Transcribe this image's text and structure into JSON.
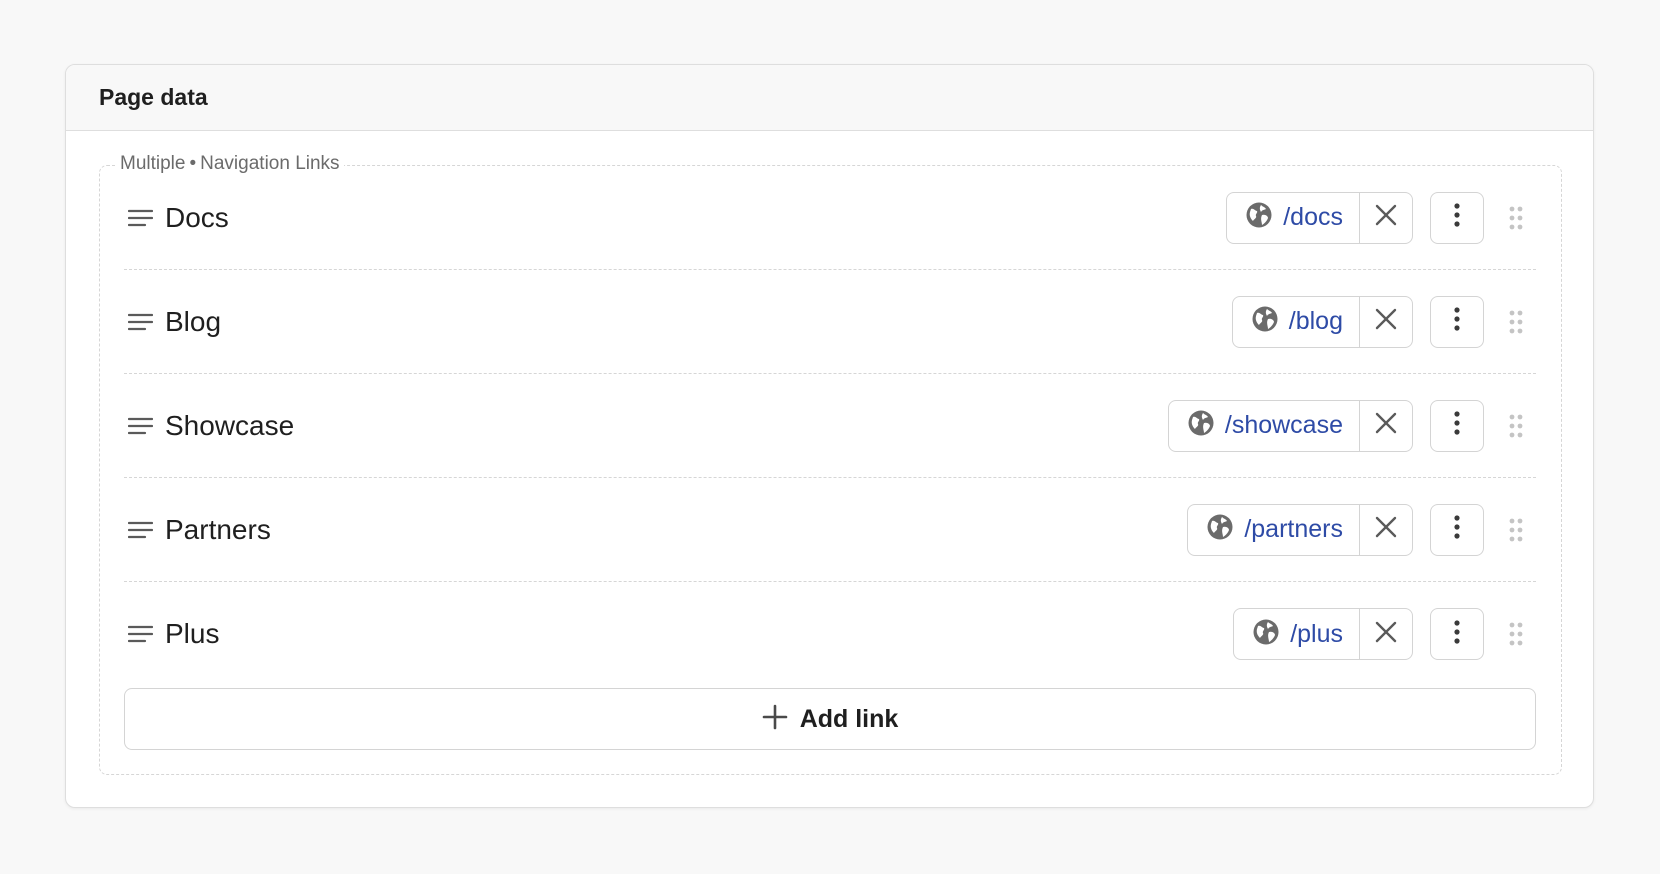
{
  "panel": {
    "title": "Page data"
  },
  "group": {
    "kind": "Multiple",
    "separator": "•",
    "name": "Navigation Links"
  },
  "links": [
    {
      "label": "Docs",
      "url": "/docs",
      "icon": "globe-icon"
    },
    {
      "label": "Blog",
      "url": "/blog",
      "icon": "globe-icon"
    },
    {
      "label": "Showcase",
      "url": "/showcase",
      "icon": "globe-icon"
    },
    {
      "label": "Partners",
      "url": "/partners",
      "icon": "globe-icon"
    },
    {
      "label": "Plus",
      "url": "/plus",
      "icon": "globe-icon"
    }
  ],
  "add_button": {
    "label": "Add link",
    "icon": "plus-icon"
  },
  "colors": {
    "link_text": "#2e4ba6",
    "icon": "#6b6b6b",
    "border": "#d4d4d4",
    "background": "#f8f8f8"
  }
}
